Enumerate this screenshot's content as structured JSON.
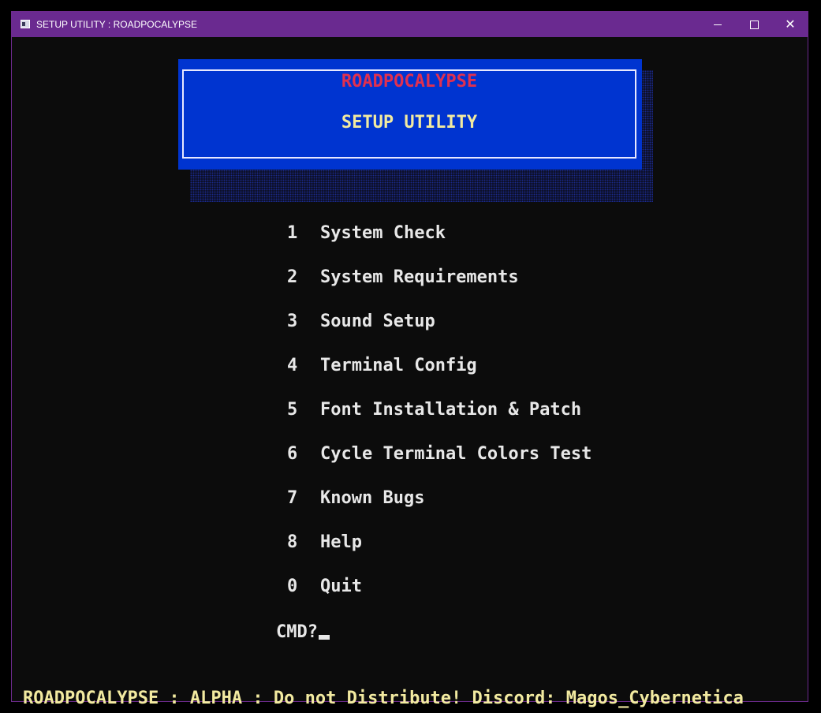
{
  "window": {
    "title": "SETUP UTILITY : ROADPOCALYPSE",
    "controls": {
      "minimize_icon": "minimize-icon",
      "maximize_icon": "maximize-icon",
      "close_icon": "close-icon",
      "close_glyph": "✕"
    },
    "accent_color": "#6a2a90"
  },
  "banner": {
    "title": "ROADPOCALYPSE",
    "subtitle": "SETUP UTILITY",
    "background_color": "#0034d0",
    "title_color": "#e03050",
    "subtitle_color": "#f2eaa0"
  },
  "menu": {
    "items": [
      {
        "key": "1",
        "label": "System Check"
      },
      {
        "key": "2",
        "label": "System Requirements"
      },
      {
        "key": "3",
        "label": "Sound Setup"
      },
      {
        "key": "4",
        "label": "Terminal Config"
      },
      {
        "key": "5",
        "label": "Font Installation & Patch"
      },
      {
        "key": "6",
        "label": "Cycle Terminal Colors Test"
      },
      {
        "key": "7",
        "label": "Known Bugs"
      },
      {
        "key": "8",
        "label": "Help"
      },
      {
        "key": "0",
        "label": "Quit"
      }
    ]
  },
  "prompt": {
    "text": "CMD?",
    "value": ""
  },
  "status_bar": {
    "text": "ROADPOCALYPSE : ALPHA : Do not Distribute!  Discord: Magos_Cybernetica",
    "color": "#f2eaa0"
  }
}
